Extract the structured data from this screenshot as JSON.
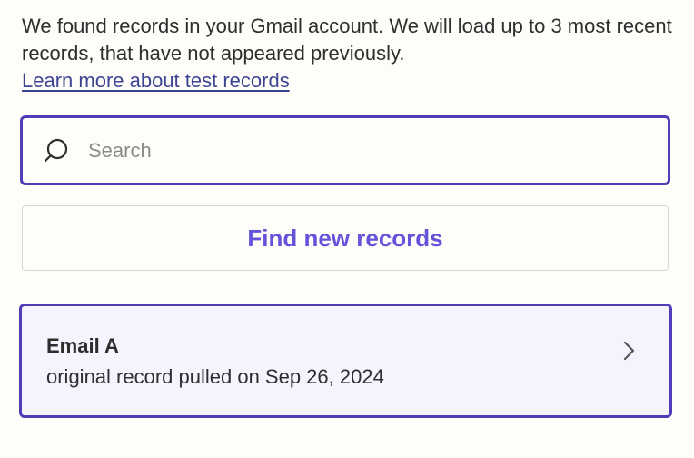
{
  "intro": {
    "message": "We found records in your Gmail account. We will load up to 3 most recent records, that have not appeared previously.",
    "learn_more_link": "Learn more about test records"
  },
  "search": {
    "placeholder": "Search",
    "value": "",
    "icon": "search-icon"
  },
  "find_button": {
    "label": "Find new records"
  },
  "records": [
    {
      "title": "Email A",
      "subtitle": "original record pulled on Sep 26, 2024",
      "icon": "chevron-right-icon"
    }
  ],
  "colors": {
    "accent_border": "#4f3fb7",
    "button_text": "#6354da",
    "link": "#3d4592",
    "card_background": "#f5f4fe",
    "page_background": "#fffdf9"
  }
}
